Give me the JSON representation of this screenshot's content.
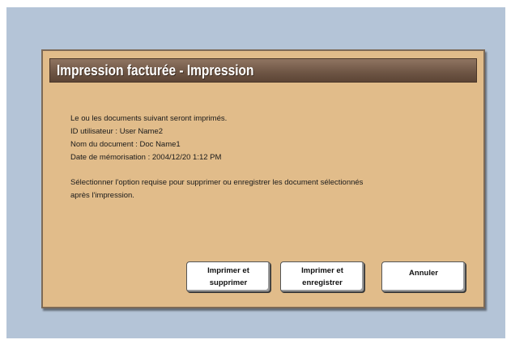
{
  "dialog": {
    "title": "Impression facturée - Impression",
    "lines": [
      "Le ou les documents suivant seront imprimés.",
      "ID utilisateur : User Name2",
      "Nom du document : Doc Name1",
      "Date de mémorisation : 2004/12/20 1:12 PM"
    ],
    "instruction_lines": [
      "Sélectionner l'option requise pour supprimer ou enregistrer les document sélectionnés",
      "après l'impression."
    ]
  },
  "buttons": {
    "print_delete": [
      "Imprimer et",
      "supprimer"
    ],
    "print_save": [
      "Imprimer et",
      "enregistrer"
    ],
    "cancel": "Annuler"
  }
}
